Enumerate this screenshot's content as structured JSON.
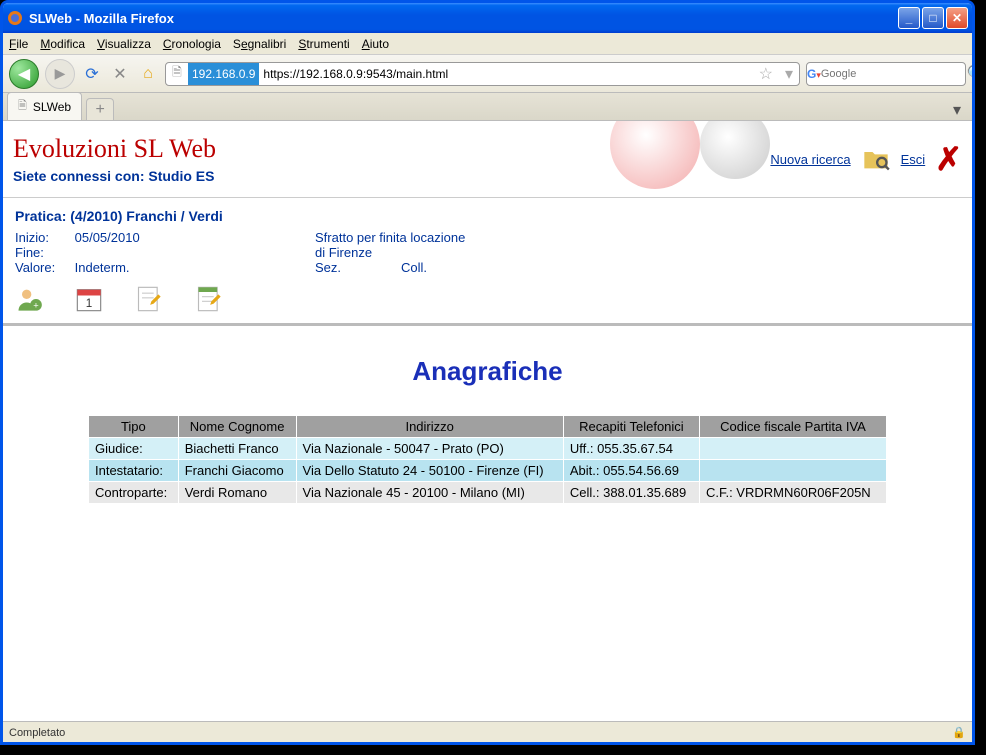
{
  "window": {
    "title": "SLWeb - Mozilla Firefox"
  },
  "menubar": {
    "file": "File",
    "edit": "Modifica",
    "view": "Visualizza",
    "history": "Cronologia",
    "bookmarks": "Segnalibri",
    "tools": "Strumenti",
    "help": "Aiuto"
  },
  "toolbar": {
    "ip_badge": "192.168.0.9",
    "url": "https://192.168.0.9:9543/main.html",
    "search_placeholder": "Google"
  },
  "tabs": {
    "active": "SLWeb"
  },
  "app": {
    "brand": "Evoluzioni SL Web",
    "connected_label": "Siete connessi con: Studio ES",
    "nuova_ricerca": "Nuova ricerca",
    "esci": "Esci"
  },
  "case": {
    "title": "Pratica: (4/2010) Franchi / Verdi",
    "inizio_label": "Inizio:",
    "inizio_value": "05/05/2010",
    "fine_label": "Fine:",
    "fine_value": "",
    "valore_label": "Valore:",
    "valore_value": "Indeterm.",
    "desc1": "Sfratto per finita locazione",
    "desc2": "di Firenze",
    "sez_label": "Sez.",
    "coll_label": "Coll."
  },
  "section": {
    "title": "Anagrafiche",
    "headers": {
      "tipo": "Tipo",
      "nome": "Nome Cognome",
      "indirizzo": "Indirizzo",
      "recapiti": "Recapiti Telefonici",
      "cf": "Codice fiscale Partita IVA"
    },
    "rows": [
      {
        "tipo": "Giudice:",
        "nome": "Biachetti Franco",
        "indirizzo": "Via Nazionale - 50047 - Prato (PO)",
        "recapiti": "Uff.: 055.35.67.54",
        "cf": ""
      },
      {
        "tipo": "Intestatario:",
        "nome": "Franchi Giacomo",
        "indirizzo": "Via Dello Statuto 24 - 50100 - Firenze (FI)",
        "recapiti": "Abit.: 055.54.56.69",
        "cf": ""
      },
      {
        "tipo": "Controparte:",
        "nome": "Verdi Romano",
        "indirizzo": "Via Nazionale 45 - 20100 - Milano (MI)",
        "recapiti": "Cell.: 388.01.35.689",
        "cf": "C.F.: VRDRMN60R06F205N"
      }
    ]
  },
  "status": {
    "text": "Completato"
  }
}
